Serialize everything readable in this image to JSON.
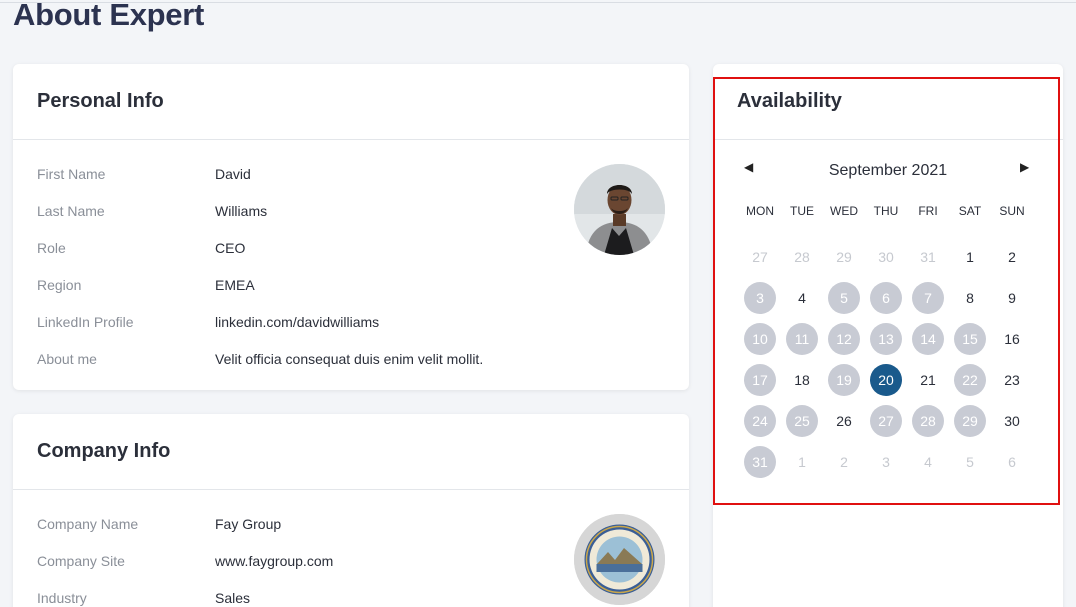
{
  "page": {
    "title": "About Expert"
  },
  "personal": {
    "header": "Personal Info",
    "rows": [
      {
        "label": "First Name",
        "value": "David"
      },
      {
        "label": "Last Name",
        "value": "Williams"
      },
      {
        "label": "Role",
        "value": "CEO"
      },
      {
        "label": "Region",
        "value": "EMEA"
      },
      {
        "label": "LinkedIn Profile",
        "value": "linkedin.com/davidwilliams"
      },
      {
        "label": "About me",
        "value": "Velit officia consequat duis enim velit mollit."
      }
    ]
  },
  "company": {
    "header": "Company Info",
    "rows": [
      {
        "label": "Company Name",
        "value": "Fay Group"
      },
      {
        "label": "Company Site",
        "value": "www.faygroup.com"
      },
      {
        "label": "Industry",
        "value": "Sales"
      }
    ]
  },
  "availability": {
    "header": "Availability",
    "month": "September 2021",
    "prev_icon": "caret-left-icon",
    "next_icon": "caret-right-icon",
    "weekdays": [
      "MON",
      "TUE",
      "WED",
      "THU",
      "FRI",
      "SAT",
      "SUN"
    ],
    "weeks": [
      [
        [
          "27",
          "muted"
        ],
        [
          "28",
          "muted"
        ],
        [
          "29",
          "muted"
        ],
        [
          "30",
          "muted"
        ],
        [
          "31",
          "muted"
        ],
        [
          "1",
          "normal"
        ],
        [
          "2",
          "normal"
        ]
      ],
      [
        [
          "3",
          "avail"
        ],
        [
          "4",
          "normal"
        ],
        [
          "5",
          "avail"
        ],
        [
          "6",
          "avail"
        ],
        [
          "7",
          "avail"
        ],
        [
          "8",
          "normal"
        ],
        [
          "9",
          "normal"
        ]
      ],
      [
        [
          "10",
          "avail"
        ],
        [
          "11",
          "avail"
        ],
        [
          "12",
          "avail"
        ],
        [
          "13",
          "avail"
        ],
        [
          "14",
          "avail"
        ],
        [
          "15",
          "avail"
        ],
        [
          "16",
          "normal"
        ]
      ],
      [
        [
          "17",
          "avail"
        ],
        [
          "18",
          "normal"
        ],
        [
          "19",
          "avail"
        ],
        [
          "20",
          "selected"
        ],
        [
          "21",
          "normal"
        ],
        [
          "22",
          "avail"
        ],
        [
          "23",
          "normal"
        ]
      ],
      [
        [
          "24",
          "avail"
        ],
        [
          "25",
          "avail"
        ],
        [
          "26",
          "normal"
        ],
        [
          "27",
          "avail"
        ],
        [
          "28",
          "avail"
        ],
        [
          "29",
          "avail"
        ],
        [
          "30",
          "normal"
        ]
      ],
      [
        [
          "31",
          "avail"
        ],
        [
          "1",
          "muted"
        ],
        [
          "2",
          "muted"
        ],
        [
          "3",
          "muted"
        ],
        [
          "4",
          "muted"
        ],
        [
          "5",
          "muted"
        ],
        [
          "6",
          "muted"
        ]
      ]
    ]
  },
  "colors": {
    "selected_day": "#1a5a8c",
    "available_day": "#c8cbd4",
    "highlight_border": "#e01010"
  }
}
